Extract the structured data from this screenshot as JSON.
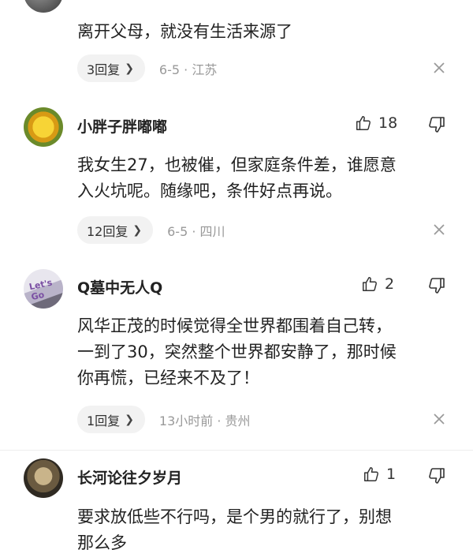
{
  "comments": [
    {
      "text": "离开父母，就没有生活来源了",
      "reply_label": "3回复",
      "meta": "6-5 · 江苏"
    },
    {
      "username": "小胖子胖嘟嘟",
      "likes": "18",
      "text": "我女生27，也被催，但家庭条件差，谁愿意\n入火坑呢。随缘吧，条件好点再说。",
      "reply_label": "12回复",
      "meta": "6-5 · 四川"
    },
    {
      "username": "Q墓中无人Q",
      "likes": "2",
      "avatar_text": "Let's Go",
      "text": "风华正茂的时候觉得全世界都围着自己转，\n一到了30，突然整个世界都安静了，那时候\n你再慌，已经来不及了！",
      "reply_label": "1回复",
      "meta": "13小时前 · 贵州"
    },
    {
      "username": "长河论往夕岁月",
      "likes": "1",
      "text": "要求放低些不行吗，是个男的就行了，别想\n那么多"
    }
  ],
  "icons": {
    "like": "thumbs-up-icon",
    "dislike": "thumbs-down-icon",
    "close": "close-icon",
    "chevron": "chevron-right-icon"
  },
  "colors": {
    "pill_bg": "#f2f2f2",
    "meta_text": "#999999"
  }
}
